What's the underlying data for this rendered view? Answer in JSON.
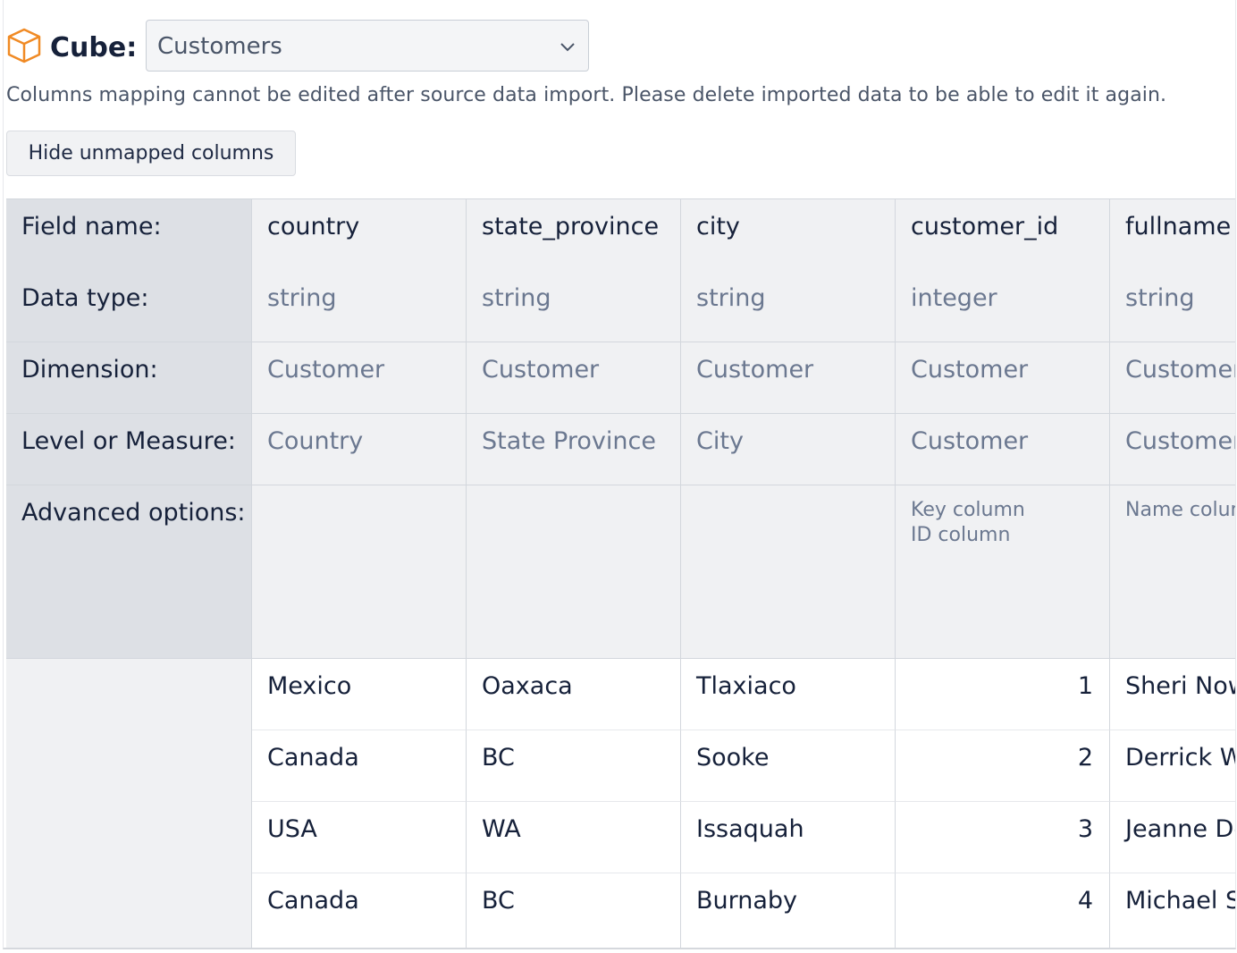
{
  "cube": {
    "label": "Cube:",
    "selected": "Customers"
  },
  "notice": "Columns mapping cannot be edited after source data import. Please delete imported data to be able to edit it again.",
  "hide_button_label": "Hide unmapped columns",
  "row_labels": {
    "field_name": "Field name:",
    "data_type": "Data type:",
    "dimension": "Dimension:",
    "level": "Level or Measure:",
    "advanced": "Advanced options:"
  },
  "columns": [
    {
      "field": "country",
      "type": "string",
      "dimension": "Customer",
      "level": "Country",
      "advanced": [
        "",
        ""
      ]
    },
    {
      "field": "state_province",
      "type": "string",
      "dimension": "Customer",
      "level": "State Province",
      "advanced": [
        "",
        ""
      ]
    },
    {
      "field": "city",
      "type": "string",
      "dimension": "Customer",
      "level": "City",
      "advanced": [
        "",
        ""
      ]
    },
    {
      "field": "customer_id",
      "type": "integer",
      "dimension": "Customer",
      "level": "Customer",
      "advanced": [
        "Key column",
        "ID column"
      ]
    },
    {
      "field": "fullname",
      "type": "string",
      "dimension": "Customer",
      "level": "Customer",
      "advanced": [
        "Name column",
        ""
      ]
    }
  ],
  "rows": [
    [
      "Mexico",
      "Oaxaca",
      "Tlaxiaco",
      "1",
      "Sheri Nowmer"
    ],
    [
      "Canada",
      "BC",
      "Sooke",
      "2",
      "Derrick Whelply"
    ],
    [
      "USA",
      "WA",
      "Issaquah",
      "3",
      "Jeanne Derry"
    ],
    [
      "Canada",
      "BC",
      "Burnaby",
      "4",
      "Michael Spence"
    ]
  ],
  "colors": {
    "accent_cube": "#f08a24",
    "header_bg": "#dde0e5",
    "meta_bg": "#f0f1f3",
    "text_dark": "#16213a",
    "text_muted": "#6b7890"
  }
}
